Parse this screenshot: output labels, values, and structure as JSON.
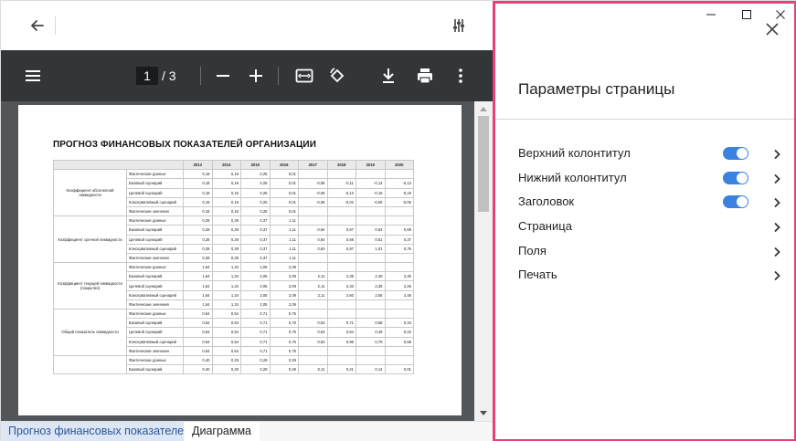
{
  "toolbar": {
    "page_current": "1",
    "page_total": "/ 3"
  },
  "document": {
    "title": "ПРОГНОЗ ФИНАНСОВЫХ ПОКАЗАТЕЛЕЙ ОРГАНИЗАЦИИ",
    "years": [
      "2013",
      "2014",
      "2015",
      "2016",
      "2017",
      "2018",
      "2019",
      "2020"
    ],
    "groups": [
      {
        "name": "Коэффициент абсолютной ликвидности",
        "rows": [
          {
            "label": "Фактические данные",
            "values": [
              "0,18",
              "0,16",
              "0,25",
              "0,01",
              "",
              "",
              "",
              ""
            ]
          },
          {
            "label": "Базовый сценарий",
            "values": [
              "0,18",
              "0,16",
              "0,25",
              "0,01",
              "-0,08",
              "-0,11",
              "-0,13",
              "-0,13"
            ]
          },
          {
            "label": "Целевой сценарий",
            "values": [
              "0,18",
              "0,16",
              "0,25",
              "0,01",
              "-0,08",
              "-0,13",
              "-0,15",
              "-0,19"
            ]
          },
          {
            "label": "Консервативный сценарий",
            "values": [
              "0,18",
              "0,16",
              "0,25",
              "0,01",
              "-0,08",
              "-0,02",
              "-0,06",
              "-0,05"
            ]
          },
          {
            "label": "Фактические значения",
            "values": [
              "0,18",
              "0,16",
              "0,25",
              "0,01",
              "",
              "",
              "",
              ""
            ]
          }
        ]
      },
      {
        "name": "Коэффициент срочной ликвидности",
        "rows": [
          {
            "label": "Фактические данные",
            "values": [
              "0,28",
              "0,29",
              "0,37",
              "1,11",
              "",
              "",
              "",
              ""
            ]
          },
          {
            "label": "Базовый сценарий",
            "values": [
              "0,28",
              "0,29",
              "0,37",
              "1,11",
              "0,64",
              "0,67",
              "0,62",
              "0,59"
            ]
          },
          {
            "label": "Целевой сценарий",
            "values": [
              "0,28",
              "0,29",
              "0,37",
              "1,11",
              "0,64",
              "0,68",
              "0,51",
              "0,37"
            ]
          },
          {
            "label": "Консервативный сценарий",
            "values": [
              "0,28",
              "0,29",
              "0,37",
              "1,11",
              "0,63",
              "0,97",
              "1,01",
              "0,76"
            ]
          },
          {
            "label": "Фактические значения",
            "values": [
              "0,28",
              "0,29",
              "0,37",
              "1,11",
              "",
              "",
              "",
              ""
            ]
          }
        ]
      },
      {
        "name": "Коэффициент текущей ликвидности (покрытия)",
        "rows": [
          {
            "label": "Фактические данные",
            "values": [
              "1,64",
              "1,34",
              "2,05",
              "2,09",
              "",
              "",
              "",
              ""
            ]
          },
          {
            "label": "Базовый сценарий",
            "values": [
              "1,64",
              "1,34",
              "2,05",
              "2,09",
              "2,11",
              "2,38",
              "2,40",
              "2,30"
            ]
          },
          {
            "label": "Целевой сценарий",
            "values": [
              "1,64",
              "1,34",
              "2,05",
              "2,09",
              "2,11",
              "2,33",
              "2,35",
              "2,26"
            ]
          },
          {
            "label": "Консервативный сценарий",
            "values": [
              "1,64",
              "1,34",
              "2,05",
              "2,09",
              "2,11",
              "2,60",
              "2,55",
              "2,46"
            ]
          },
          {
            "label": "Фактические значения",
            "values": [
              "1,64",
              "1,34",
              "2,05",
              "2,09",
              "",
              "",
              "",
              ""
            ]
          }
        ]
      },
      {
        "name": "Общий показатель ликвидности",
        "rows": [
          {
            "label": "Фактические данные",
            "values": [
              "0,64",
              "0,54",
              "0,71",
              "0,75",
              "",
              "",
              "",
              ""
            ]
          },
          {
            "label": "Базовый сценарий",
            "values": [
              "0,64",
              "0,54",
              "0,71",
              "0,75",
              "0,53",
              "0,71",
              "0,58",
              "0,34"
            ]
          },
          {
            "label": "Целевой сценарий",
            "values": [
              "0,64",
              "0,54",
              "0,71",
              "0,75",
              "0,53",
              "0,64",
              "0,49",
              "0,22"
            ]
          },
          {
            "label": "Консервативный сценарий",
            "values": [
              "0,64",
              "0,54",
              "0,71",
              "0,75",
              "0,53",
              "0,96",
              "0,79",
              "0,58"
            ]
          },
          {
            "label": "Фактические значения",
            "values": [
              "0,64",
              "0,54",
              "0,71",
              "0,75",
              "",
              "",
              "",
              ""
            ]
          }
        ]
      },
      {
        "name": "",
        "rows": [
          {
            "label": "Фактические данные",
            "values": [
              "0,40",
              "0,26",
              "0,29",
              "0,29",
              "",
              "",
              "",
              ""
            ]
          },
          {
            "label": "Базовый сценарий",
            "values": [
              "0,40",
              "0,26",
              "0,29",
              "0,29",
              "0,11",
              "0,21",
              "0,14",
              "0,01"
            ]
          }
        ]
      }
    ]
  },
  "tabs": [
    {
      "label": "Прогноз финансовых показателей",
      "active": true
    },
    {
      "label": "Диаграмма",
      "active": false
    }
  ],
  "panel": {
    "title": "Параметры страницы",
    "items": [
      {
        "label": "Верхний колонтитул",
        "toggle": true
      },
      {
        "label": "Нижний колонтитул",
        "toggle": true
      },
      {
        "label": "Заголовок",
        "toggle": true
      },
      {
        "label": "Страница",
        "toggle": false
      },
      {
        "label": "Поля",
        "toggle": false
      },
      {
        "label": "Печать",
        "toggle": false
      }
    ]
  },
  "colors": {
    "panel_border": "#e8417a",
    "toggle_on": "#3b82e0",
    "pdf_toolbar": "#323639",
    "viewer_bg": "#525659",
    "active_tab_bg": "#dce6f4",
    "active_tab_text": "#2b579a"
  },
  "icons": [
    "back-arrow-icon",
    "tune-icon",
    "menu-icon",
    "minus-icon",
    "plus-icon",
    "fit-page-icon",
    "rotate-icon",
    "download-icon",
    "print-icon",
    "more-vert-icon",
    "minimize-icon",
    "maximize-icon",
    "window-close-icon",
    "close-icon",
    "chevron-right-icon"
  ]
}
